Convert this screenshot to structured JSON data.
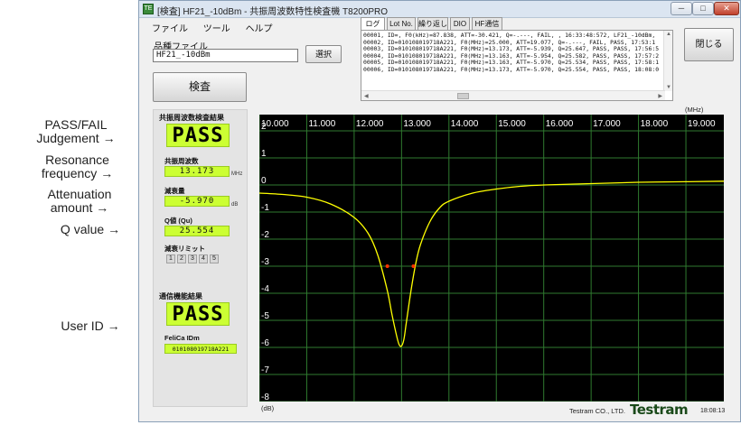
{
  "callouts": {
    "pass_fail": {
      "line1": "PASS/FAIL",
      "line2": "Judgement"
    },
    "resonance": {
      "line1": "Resonance",
      "line2": "frequency"
    },
    "attenuation": {
      "line1": "Attenuation",
      "line2": "amount"
    },
    "q_value": "Q value",
    "user_id": "User ID",
    "arrow": "→"
  },
  "window": {
    "title": "[検査] HF21_-10dBm - 共振周波数特性検査機 T8200PRO",
    "icon_text": "TE",
    "min_label": "─",
    "max_label": "□",
    "close_label": "✕"
  },
  "menu": [
    "ファイル",
    "ツール",
    "ヘルプ"
  ],
  "product_file": {
    "label": "品種ファイル",
    "value": "HF21_-10dBm"
  },
  "buttons": {
    "select": "選択",
    "inspect": "検査",
    "close": "閉じる"
  },
  "log": {
    "tabs": [
      "ログ",
      "Lot No.",
      "繰り返し",
      "DIO",
      "HF通信"
    ],
    "lines": [
      "00001, ID=, F0(kHz)=87.838, ATT=-30.421, Q=-.---, FAIL, , 16:33:48:572, LF21_-10dBm,",
      "00002, ID=010108019718A221, F0(MHz)=25.000, ATT=19.077, Q=-.---, FAIL, PASS, 17:53:1",
      "00003, ID=010108019718A221, F0(MHz)=13.173, ATT=-5.939, Q=25.647, PASS, PASS, 17:56:5",
      "00004, ID=010108019718A221, F0(MHz)=13.163, ATT=-5.954, Q=25.582, PASS, PASS, 17:57:2",
      "00005, ID=010108019718A221, F0(MHz)=13.163, ATT=-5.970, Q=25.534, PASS, PASS, 17:58:1",
      "00006, ID=010108019718A221, F0(MHz)=13.173, ATT=-5.970, Q=25.554, PASS, PASS, 18:08:0"
    ]
  },
  "judgement": {
    "title": "共振周波数検査結果",
    "result": "PASS",
    "resonance_label": "共振周波数",
    "resonance_value": "13.173",
    "resonance_unit": "MHz",
    "attenuation_label": "減衰量",
    "attenuation_value": "-5.970",
    "attenuation_unit": "dB",
    "q_label": "Q値 (Qu)",
    "q_value": "25.554",
    "limit_label": "減衰リミット",
    "limit_cells": [
      "1",
      "2",
      "3",
      "4",
      "5"
    ]
  },
  "comm": {
    "title": "通信機能結果",
    "result": "PASS",
    "id_label": "FeliCa IDm",
    "id_value": "010108019718A221"
  },
  "chart_data": {
    "type": "line",
    "x_unit": "(MHz)",
    "y_unit": "(dB)",
    "xlim": [
      10.0,
      19.8
    ],
    "ylim": [
      -8,
      2.6
    ],
    "x_ticks": [
      "10.000",
      "11.000",
      "12.000",
      "13.000",
      "14.000",
      "15.000",
      "16.000",
      "17.000",
      "18.000",
      "19.000"
    ],
    "y_ticks": [
      "2",
      "1",
      "0",
      "-1",
      "-2",
      "-3",
      "-4",
      "-5",
      "-6",
      "-7",
      "-8"
    ],
    "series": [
      {
        "color": "#ffff00",
        "x": [
          10.0,
          10.5,
          11.0,
          11.5,
          12.0,
          12.3,
          12.5,
          12.7,
          12.8,
          12.9,
          12.95,
          13.0,
          13.05,
          13.1,
          13.2,
          13.3,
          13.4,
          13.6,
          13.8,
          14.0,
          14.5,
          15.0,
          15.5,
          16.0,
          17.0,
          18.0,
          19.0,
          19.8
        ],
        "y": [
          -0.3,
          -0.35,
          -0.45,
          -0.7,
          -1.2,
          -1.8,
          -2.6,
          -3.9,
          -4.8,
          -5.6,
          -5.9,
          -5.95,
          -5.7,
          -5.1,
          -3.9,
          -2.9,
          -2.2,
          -1.35,
          -0.85,
          -0.6,
          -0.3,
          -0.15,
          -0.05,
          0.0,
          0.05,
          0.1,
          0.12,
          0.14
        ]
      }
    ],
    "markers": {
      "color": "#ff3300",
      "points": [
        {
          "x": 12.7,
          "y": -3.0
        },
        {
          "x": 13.25,
          "y": -3.0
        }
      ]
    },
    "grid": true,
    "background": "#000000",
    "grid_color": "#2f7a2f"
  },
  "footer": {
    "company": "Testram CO., LTD.",
    "brand": "Testram",
    "time": "18:08:13"
  }
}
